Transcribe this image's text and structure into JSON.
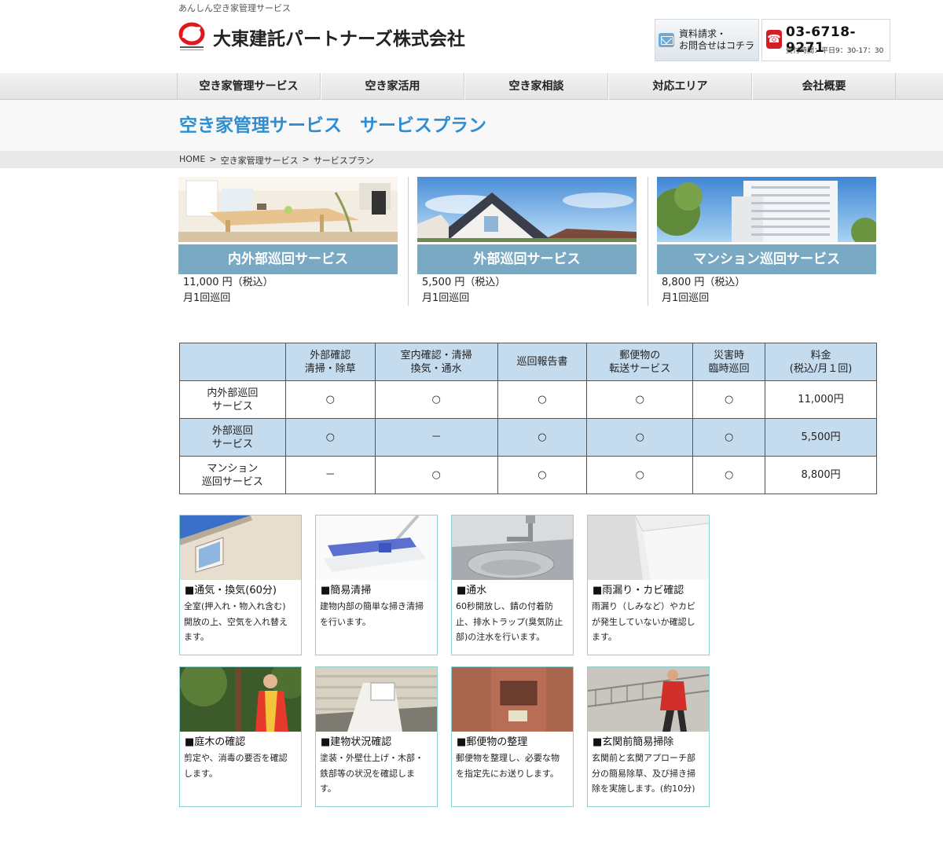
{
  "header": {
    "tagline": "あんしん空き家管理サービス",
    "company_name": "大東建託パートナーズ株式会社",
    "contact_button": {
      "line1": "資料請求・",
      "line2": "お問合せはコチラ"
    },
    "phone": {
      "number": "03-6718-9271",
      "hours": "受付時間：平日9：30-17：30"
    }
  },
  "nav": {
    "items": [
      "空き家管理サービス",
      "空き家活用",
      "空き家相談",
      "対応エリア",
      "会社概要"
    ]
  },
  "page_title": "空き家管理サービス　サービスプラン",
  "breadcrumb": {
    "items": [
      "HOME",
      "空き家管理サービス",
      "サービスプラン"
    ],
    "separator": ">"
  },
  "plans": [
    {
      "name": "内外部巡回サービス",
      "price": "11,000 円（税込）",
      "frequency": "月1回巡回"
    },
    {
      "name": "外部巡回サービス",
      "price": "5,500 円（税込）",
      "frequency": "月1回巡回"
    },
    {
      "name": "マンション巡回サービス",
      "price": "8,800 円（税込）",
      "frequency": "月1回巡回"
    }
  ],
  "comparison_table": {
    "headers": [
      [
        "",
        ""
      ],
      [
        "外部確認",
        "清掃・除草"
      ],
      [
        "室内確認・清掃",
        "換気・通水"
      ],
      [
        "巡回報告書",
        ""
      ],
      [
        "郵便物の",
        "転送サービス"
      ],
      [
        "災害時",
        "臨時巡回"
      ],
      [
        "料金",
        "(税込/月１回)"
      ]
    ],
    "rows": [
      {
        "plan": [
          "内外部巡回",
          "サービス"
        ],
        "cells": [
          "○",
          "○",
          "○",
          "○",
          "○"
        ],
        "price": "11,000円"
      },
      {
        "plan": [
          "外部巡回",
          "サービス"
        ],
        "cells": [
          "○",
          "－",
          "○",
          "○",
          "○"
        ],
        "price": "5,500円"
      },
      {
        "plan": [
          "マンション",
          "巡回サービス"
        ],
        "cells": [
          "－",
          "○",
          "○",
          "○",
          "○"
        ],
        "price": "8,800円"
      }
    ]
  },
  "features": [
    {
      "title": "■通気・換気(60分)",
      "desc": [
        "全室(押入れ・物入れ含む)",
        "開放の上、空気を入れ替え",
        "ます。"
      ]
    },
    {
      "title": "■簡易清掃",
      "desc": [
        "建物内部の簡単な掃き清掃",
        "を行います。"
      ]
    },
    {
      "title": "■通水",
      "desc": [
        "60秒開放し、錆の付着防",
        "止、排水トラップ(臭気防止",
        "部)の注水を行います。"
      ]
    },
    {
      "title": "■雨漏り・カビ確認",
      "desc": [
        "雨漏り（しみなど）やカビ",
        "が発生していないか確認し",
        "ます。"
      ]
    },
    {
      "title": "■庭木の確認",
      "desc": [
        "剪定や、消毒の要否を確認",
        "します。"
      ]
    },
    {
      "title": "■建物状況確認",
      "desc": [
        "塗装・外壁仕上げ・木部・",
        "鉄部等の状況を確認しま",
        "す。"
      ]
    },
    {
      "title": "■郵便物の整理",
      "desc": [
        "郵便物を整理し、必要な物",
        "を指定先にお送りします。"
      ]
    },
    {
      "title": "■玄関前簡易掃除",
      "desc": [
        "玄関前と玄関アプローチ部",
        "分の簡易除草、及び掃き掃",
        "除を実施します。(約10分)"
      ]
    }
  ]
}
